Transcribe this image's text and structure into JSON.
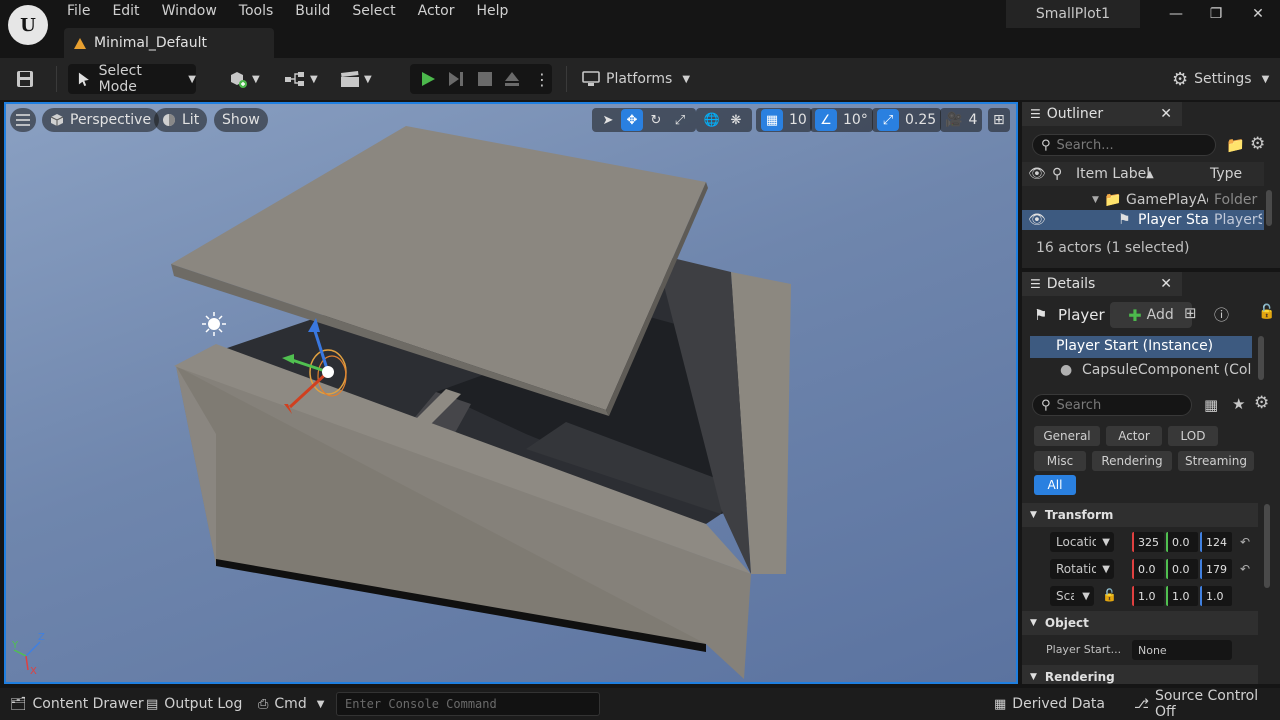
{
  "menu": [
    "File",
    "Edit",
    "Window",
    "Tools",
    "Build",
    "Select",
    "Actor",
    "Help"
  ],
  "document_tab": "Minimal_Default",
  "project_name": "SmallPlot1",
  "toolbar": {
    "select_mode": "Select Mode",
    "platforms": "Platforms",
    "settings": "Settings"
  },
  "viewport": {
    "perspective": "Perspective",
    "lit": "Lit",
    "show": "Show",
    "grid_snap": "10",
    "rotation_snap": "10°",
    "scale_snap": "0.25",
    "camera_speed": "4"
  },
  "outliner": {
    "title": "Outliner",
    "search_placeholder": "Search...",
    "col_label": "Item Label",
    "col_type": "Type",
    "rows": [
      {
        "label": "GamePlayActors",
        "type": "Folder"
      },
      {
        "label": "Player Start",
        "type": "PlayerStart"
      }
    ],
    "status": "16 actors (1 selected)"
  },
  "details": {
    "title": "Details",
    "actor_name": "Player",
    "add_label": "Add",
    "components": [
      "Player Start (Instance)",
      "CapsuleComponent (CollisionCylinder)"
    ],
    "search_placeholder": "Search",
    "filters": [
      "General",
      "Actor",
      "LOD",
      "Misc",
      "Rendering",
      "Streaming",
      "All"
    ],
    "sections": {
      "transform": "Transform",
      "object": "Object",
      "rendering": "Rendering"
    },
    "location_label": "Location",
    "rotation_label": "Rotation",
    "scale_label": "Scale",
    "location": [
      "325",
      "0.0",
      "124"
    ],
    "rotation": [
      "0.0",
      "0.0",
      "179"
    ],
    "scale": [
      "1.0",
      "1.0",
      "1.0"
    ],
    "player_start_label": "Player Start...",
    "player_start_value": "None"
  },
  "statusbar": {
    "content_drawer": "Content Drawer",
    "output_log": "Output Log",
    "cmd": "Cmd",
    "console_placeholder": "Enter Console Command",
    "derived_data": "Derived Data",
    "source_control": "Source Control Off"
  },
  "colors": {
    "accent": "#2a80e0",
    "play": "#4cb84c",
    "x_axis": "#e04040",
    "y_axis": "#50c050",
    "z_axis": "#4080e0"
  }
}
